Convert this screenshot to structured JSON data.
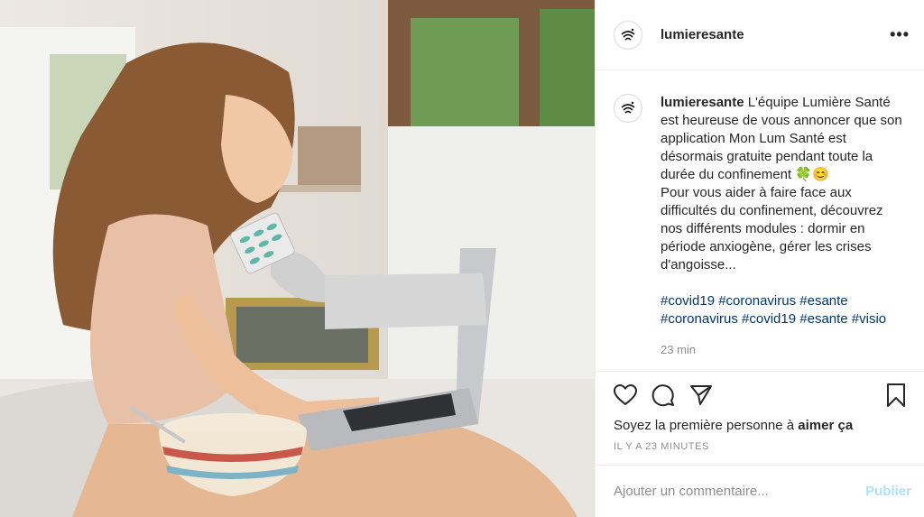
{
  "post": {
    "username": "lumieresante",
    "more_label": "•••",
    "caption": {
      "username": "lumieresante",
      "text_1": "L'équipe Lumière Santé est heureuse de vous annoncer que son application Mon Lum Santé est désormais gratuite pendant toute la durée du confinement 🍀😊",
      "text_2": "Pour vous aider à faire face aux difficultés du confinement, découvrez nos différents modules : dormir en période anxiogène, gérer les crises d'angoisse...",
      "hashtags_1": "#covid19 #coronavirus #esante",
      "hashtags_2": "#coronavirus #covid19 #esante #visio",
      "time": "23 min"
    },
    "likes_prefix": "Soyez la première personne à ",
    "likes_bold": "aimer ça",
    "posted_ago": "IL Y A 23 MINUTES",
    "comment_placeholder": "Ajouter un commentaire...",
    "publish_label": "Publier"
  },
  "icons": {
    "avatar": "lumiere-logo-icon",
    "like": "heart-icon",
    "comment": "comment-icon",
    "share": "share-icon",
    "save": "bookmark-icon"
  }
}
